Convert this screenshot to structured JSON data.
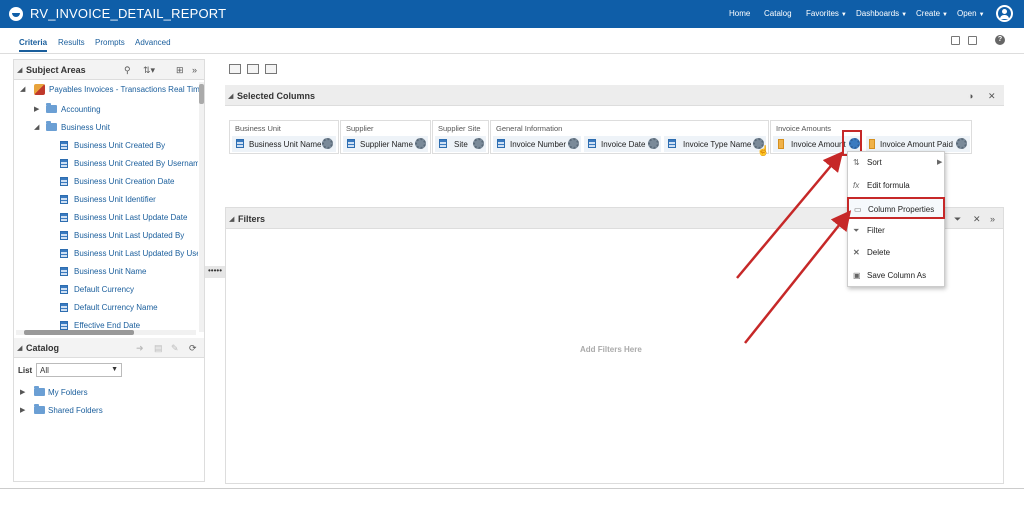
{
  "app": {
    "title": "RV_INVOICE_DETAIL_REPORT"
  },
  "topnav": {
    "home": "Home",
    "catalog": "Catalog",
    "favorites": "Favorites",
    "dashboards": "Dashboards",
    "create": "Create",
    "open": "Open"
  },
  "tabs": [
    "Criteria",
    "Results",
    "Prompts",
    "Advanced"
  ],
  "subject_areas": {
    "title": "Subject Areas",
    "root": "Payables Invoices - Transactions Real Tim",
    "folders": [
      "Accounting",
      "Business Unit"
    ],
    "columns": [
      "Business Unit Created By",
      "Business Unit Created By Usernam",
      "Business Unit Creation Date",
      "Business Unit Identifier",
      "Business Unit Last Update Date",
      "Business Unit Last Updated By",
      "Business Unit Last Updated By Use",
      "Business Unit Name",
      "Default Currency",
      "Default Currency Name",
      "Effective End Date"
    ]
  },
  "catalog": {
    "title": "Catalog",
    "list_label": "List",
    "list_value": "All",
    "folders": [
      "My Folders",
      "Shared Folders"
    ]
  },
  "splitter": "•••••",
  "selected_columns": {
    "title": "Selected Columns",
    "groups": [
      {
        "name": "Business Unit",
        "columns": [
          "Business Unit Name"
        ]
      },
      {
        "name": "Supplier",
        "columns": [
          "Supplier Name"
        ]
      },
      {
        "name": "Supplier Site",
        "columns": [
          "Site"
        ]
      },
      {
        "name": "General Information",
        "columns": [
          "Invoice Number",
          "Invoice Date",
          "Invoice Type Name"
        ]
      },
      {
        "name": "Invoice Amounts",
        "columns": [
          "Invoice Amount",
          "Invoice Amount Paid"
        ]
      }
    ]
  },
  "context_menu": {
    "items": [
      {
        "label": "Sort",
        "icon": "sort-icon"
      },
      {
        "label": "Edit formula",
        "icon": "fx-icon"
      },
      {
        "label": "Column Properties",
        "icon": "column-properties-icon"
      },
      {
        "label": "Filter",
        "icon": "filter-icon"
      },
      {
        "label": "Delete",
        "icon": "delete-icon"
      },
      {
        "label": "Save Column As",
        "icon": "save-icon"
      }
    ]
  },
  "filters": {
    "title": "Filters",
    "placeholder": "Add Filters Here"
  },
  "colors": {
    "brand": "#0f5ea8",
    "highlight": "#c62828"
  }
}
